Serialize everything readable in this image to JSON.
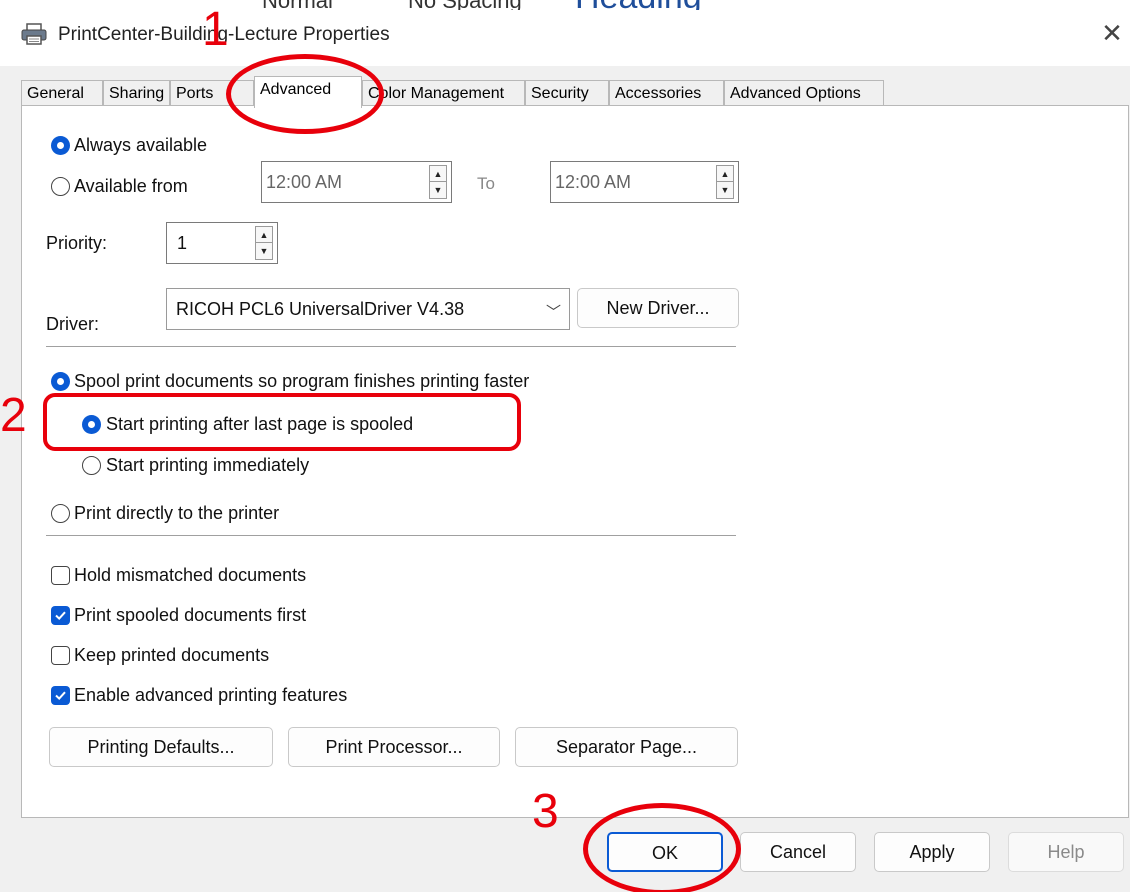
{
  "window": {
    "title": "PrintCenter-Building-Lecture Properties",
    "close_glyph": "✕"
  },
  "background_fragments": [
    "Normal",
    "No Spacing",
    "Heading"
  ],
  "tabs": [
    {
      "label": "General"
    },
    {
      "label": "Sharing"
    },
    {
      "label": "Ports"
    },
    {
      "label": "Advanced",
      "active": true
    },
    {
      "label": "Color Management"
    },
    {
      "label": "Security"
    },
    {
      "label": "Accessories"
    },
    {
      "label": "Advanced Options"
    }
  ],
  "availability": {
    "always_label": "Always available",
    "always_selected": true,
    "from_label": "Available from",
    "from_time": "12:00 AM",
    "to_label": "To",
    "to_time": "12:00 AM"
  },
  "priority": {
    "label": "Priority:",
    "value": "1"
  },
  "driver": {
    "label": "Driver:",
    "value": "RICOH PCL6 UniversalDriver V4.38",
    "new_driver_button": "New Driver..."
  },
  "spooling": {
    "spool_label": "Spool print documents so program finishes printing faster",
    "spool_selected": true,
    "after_last_page_label": "Start printing after last page is spooled",
    "after_last_page_selected": true,
    "immediately_label": "Start printing immediately",
    "immediately_selected": false,
    "direct_label": "Print directly to the printer",
    "direct_selected": false
  },
  "options": [
    {
      "label": "Hold mismatched documents",
      "checked": false
    },
    {
      "label": "Print spooled documents first",
      "checked": true
    },
    {
      "label": "Keep printed documents",
      "checked": false
    },
    {
      "label": "Enable advanced printing features",
      "checked": true
    }
  ],
  "panel_buttons": {
    "printing_defaults": "Printing Defaults...",
    "print_processor": "Print Processor...",
    "separator_page": "Separator Page..."
  },
  "footer_buttons": {
    "ok": "OK",
    "cancel": "Cancel",
    "apply": "Apply",
    "help": "Help"
  },
  "annotations": {
    "step1": "1",
    "step2": "2",
    "step3": "3",
    "color": "#e8000b"
  },
  "colors": {
    "accent": "#0a5ad4",
    "dialog_bg": "#f0f0f0"
  }
}
